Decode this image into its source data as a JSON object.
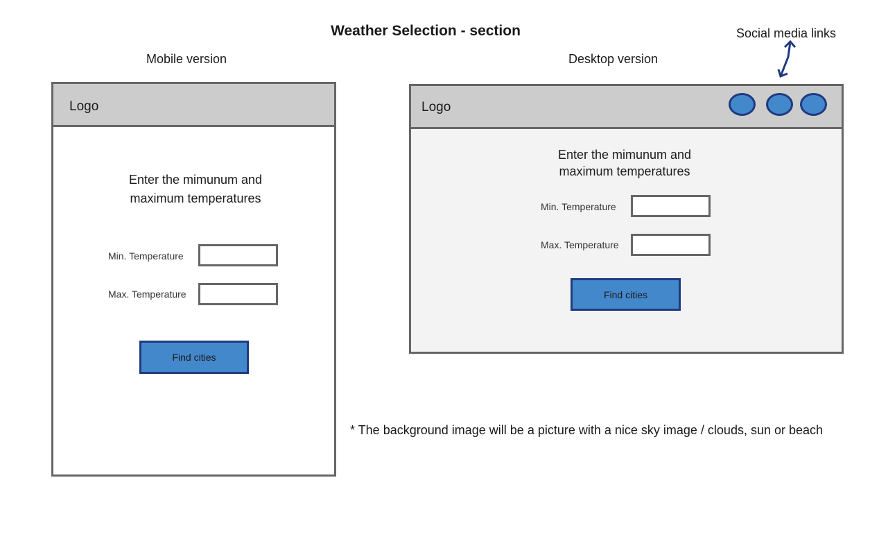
{
  "title": "Weather Selection - section",
  "social_label": "Social media links",
  "mobile": {
    "label": "Mobile version",
    "logo": "Logo",
    "heading_line1": "Enter the mimunum and",
    "heading_line2": "maximum temperatures",
    "min_label": "Min. Temperature",
    "max_label": "Max. Temperature",
    "button": "Find cities"
  },
  "desktop": {
    "label": "Desktop version",
    "logo": "Logo",
    "heading_line1": "Enter the mimunum and",
    "heading_line2": "maximum temperatures",
    "min_label": "Min. Temperature",
    "max_label": "Max. Temperature",
    "button": "Find cities",
    "social_icons": [
      "social-link",
      "social-link",
      "social-link"
    ]
  },
  "note": "* The background image will be a picture with a nice sky image / clouds, sun or beach",
  "colors": {
    "accent": "#4488cc",
    "accent_border": "#1f3a80",
    "header": "#cccccc",
    "frame": "#666666"
  }
}
